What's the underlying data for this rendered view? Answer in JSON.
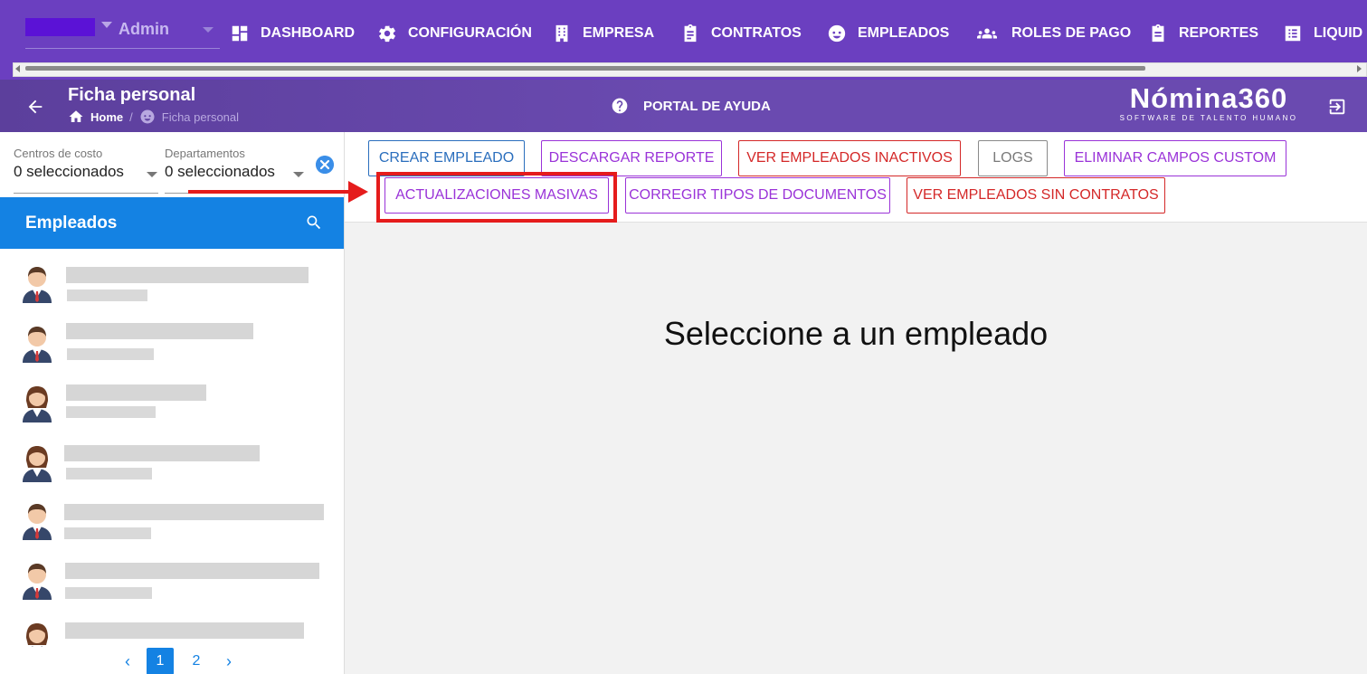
{
  "topbar": {
    "role": "Admin",
    "nav": [
      {
        "label": "DASHBOARD",
        "icon": "dashboard-icon"
      },
      {
        "label": "CONFIGURACIÓN",
        "icon": "gear-icon"
      },
      {
        "label": "EMPRESA",
        "icon": "building-icon"
      },
      {
        "label": "CONTRATOS",
        "icon": "clipboard-icon"
      },
      {
        "label": "EMPLEADOS",
        "icon": "face-icon"
      },
      {
        "label": "ROLES DE PAGO",
        "icon": "people-icon"
      },
      {
        "label": "REPORTES",
        "icon": "report-icon"
      },
      {
        "label": "LIQUID",
        "icon": "list-icon"
      }
    ]
  },
  "subheader": {
    "title": "Ficha personal",
    "breadcrumb_home": "Home",
    "breadcrumb_sep": "/",
    "breadcrumb_current": "Ficha personal",
    "help_label": "PORTAL DE AYUDA",
    "brand_name": "Nómina360",
    "brand_tagline": "SOFTWARE DE TALENTO HUMANO"
  },
  "filters": {
    "cost_centers_label": "Centros de costo",
    "cost_centers_value": "0 seleccionados",
    "departments_label": "Departamentos",
    "departments_value": "0 seleccionados"
  },
  "employees": {
    "title": "Empleados",
    "rows": [
      {
        "gender": "male"
      },
      {
        "gender": "male"
      },
      {
        "gender": "female"
      },
      {
        "gender": "female"
      },
      {
        "gender": "male"
      },
      {
        "gender": "male"
      },
      {
        "gender": "female"
      }
    ],
    "pages": [
      "1",
      "2"
    ],
    "active_page": "1"
  },
  "toolbar": {
    "crear_empleado": "CREAR EMPLEADO",
    "descargar_reporte": "DESCARGAR REPORTE",
    "ver_inactivos": "VER EMPLEADOS INACTIVOS",
    "logs": "LOGS",
    "eliminar_campos": "ELIMINAR CAMPOS CUSTOM",
    "actualizaciones_masivas": "ACTUALIZACIONES MASIVAS",
    "corregir_tipos": "CORREGIR TIPOS DE DOCUMENTOS",
    "ver_sin_contratos": "VER EMPLEADOS SIN CONTRATOS"
  },
  "main": {
    "empty_message": "Seleccione a un empleado"
  },
  "colors": {
    "topbar": "#6b3fc0",
    "accent_blue": "#1482e3",
    "highlight_red": "#e51c1c"
  }
}
